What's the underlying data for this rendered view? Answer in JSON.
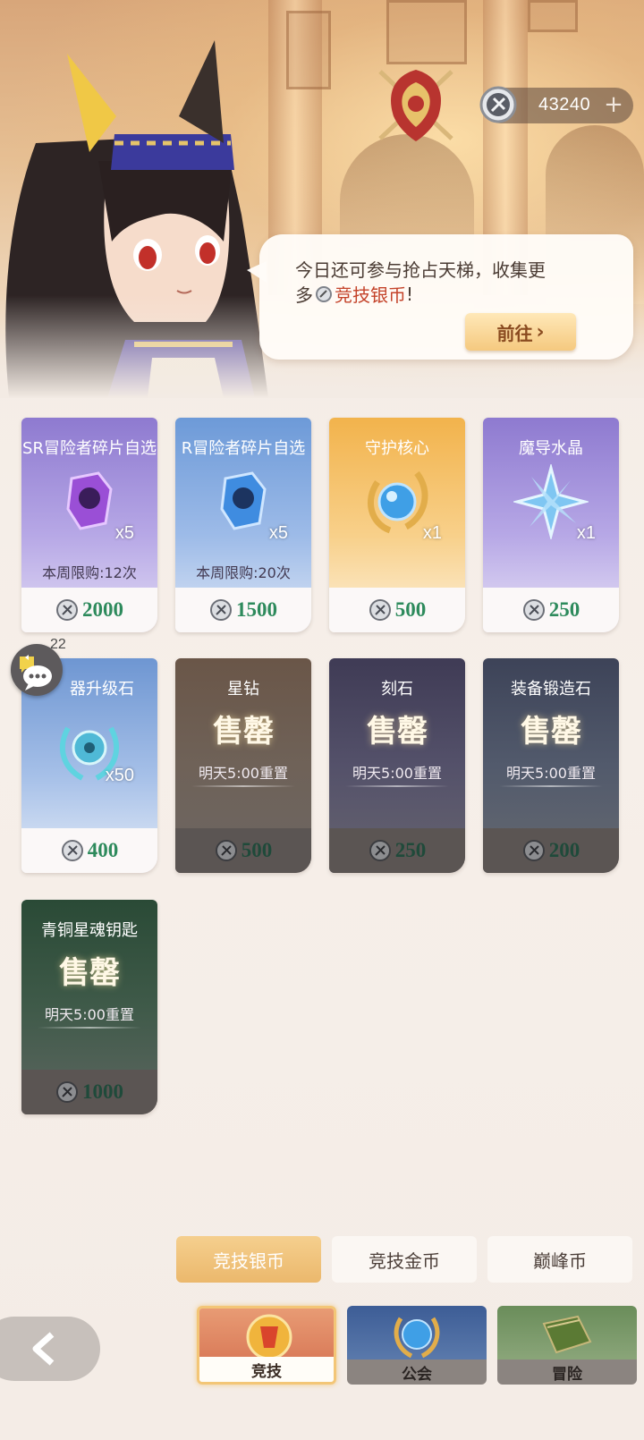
{
  "currency": {
    "amount": "43240",
    "plus": "+",
    "icon": "silver-arena-coin-icon"
  },
  "bubble": {
    "line1": "今日还可参与抢占天梯，收集更",
    "line2_prefix": "多",
    "line2_highlight": "竞技银币",
    "line2_suffix": "!",
    "button": "前往",
    "button_icon": "chevron-right-icon"
  },
  "chat": {
    "badge": "22"
  },
  "items": [
    {
      "title": "SR冒险者碎片自选",
      "qty": "x5",
      "limit": "本周限购:12次",
      "price": "2000",
      "sold_out": false
    },
    {
      "title": "R冒险者碎片自选",
      "qty": "x5",
      "limit": "本周限购:20次",
      "price": "1500",
      "sold_out": false
    },
    {
      "title": "守护核心",
      "qty": "x1",
      "limit": "",
      "price": "500",
      "sold_out": false
    },
    {
      "title": "魔导水晶",
      "qty": "x1",
      "limit": "",
      "price": "250",
      "sold_out": false
    },
    {
      "title": "圣器升级石",
      "title_visible": "器升级石",
      "qty": "x50",
      "limit": "",
      "price": "400",
      "sold_out": false
    },
    {
      "title": "星钻",
      "price": "500",
      "sold_out": true
    },
    {
      "title": "刻石",
      "price": "250",
      "sold_out": true
    },
    {
      "title": "装备锻造石",
      "price": "200",
      "sold_out": true
    },
    {
      "title": "青铜星魂钥匙",
      "price": "1000",
      "sold_out": true
    }
  ],
  "sold_out_text": "售罄",
  "reset_text": "明天5:00重置",
  "currency_tabs": [
    {
      "label": "竞技银币",
      "active": true
    },
    {
      "label": "竞技金币",
      "active": false
    },
    {
      "label": "巅峰币",
      "active": false
    }
  ],
  "shop_tabs": [
    {
      "label": "竞技",
      "active": true
    },
    {
      "label": "公会",
      "active": false
    },
    {
      "label": "冒险",
      "active": false
    }
  ],
  "colors": {
    "price_green": "#2d8a5c",
    "tab_active": "#ebb86c",
    "highlight_red": "#c4432a"
  }
}
